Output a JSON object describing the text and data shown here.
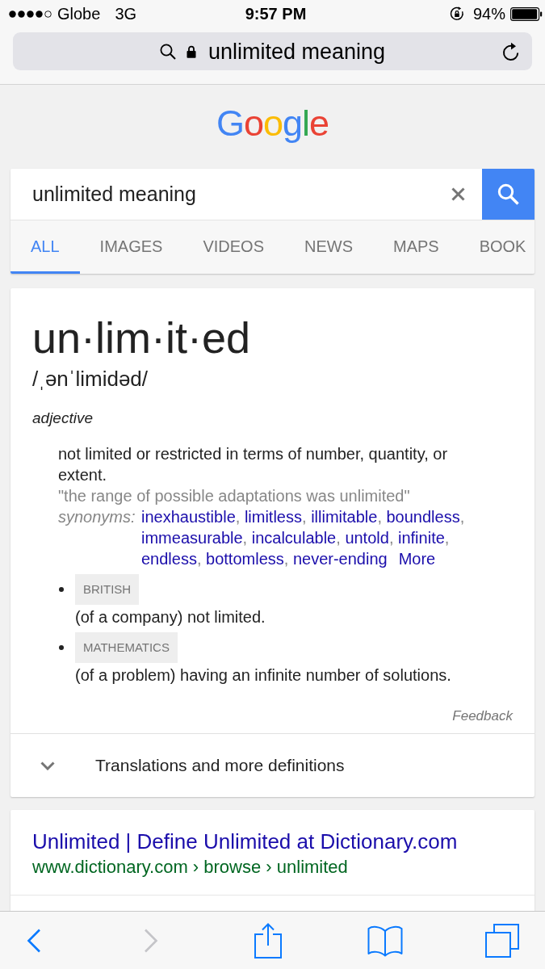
{
  "status_bar": {
    "carrier": "Globe",
    "network": "3G",
    "time": "9:57 PM",
    "battery": "94%"
  },
  "address_bar": {
    "text": "unlimited meaning",
    "secure": true
  },
  "logo": "Google",
  "search": {
    "value": "unlimited meaning"
  },
  "tabs": [
    {
      "label": "ALL",
      "selected": true
    },
    {
      "label": "IMAGES",
      "selected": false
    },
    {
      "label": "VIDEOS",
      "selected": false
    },
    {
      "label": "NEWS",
      "selected": false
    },
    {
      "label": "MAPS",
      "selected": false
    },
    {
      "label": "BOOK",
      "selected": false
    }
  ],
  "definition": {
    "word": "un·lim·it·ed",
    "phonetic": "/ˌənˈlimidəd/",
    "part_of_speech": "adjective",
    "meaning": "not limited or restricted in terms of number, quantity, or extent.",
    "example": "\"the range of possible adaptations was unlimited\"",
    "synonyms": {
      "label": "synonyms:",
      "items": [
        "inexhaustible",
        "limitless",
        "illimitable",
        "boundless",
        "immeasurable",
        "incalculable",
        "untold",
        "infinite",
        "endless",
        "bottomless",
        "never-ending"
      ],
      "separator": ",",
      "more": "More"
    },
    "subsenses": [
      {
        "label": "BRITISH",
        "text": "(of a company) not limited."
      },
      {
        "label": "MATHEMATICS",
        "text": "(of a problem) having an infinite number of solutions."
      }
    ],
    "feedback": "Feedback"
  },
  "expander": {
    "label": "Translations and more definitions",
    "expanded": false
  },
  "results": [
    {
      "title": "Unlimited | Define Unlimited at Dictionary.com",
      "url": "www.dictionary.com › browse › unlimited"
    }
  ],
  "toolbar": [
    {
      "kind": "back",
      "disabled": false
    },
    {
      "kind": "forward",
      "disabled": true
    },
    {
      "kind": "share",
      "disabled": false
    },
    {
      "kind": "bookmarks",
      "disabled": false
    },
    {
      "kind": "tabs",
      "disabled": false
    }
  ]
}
